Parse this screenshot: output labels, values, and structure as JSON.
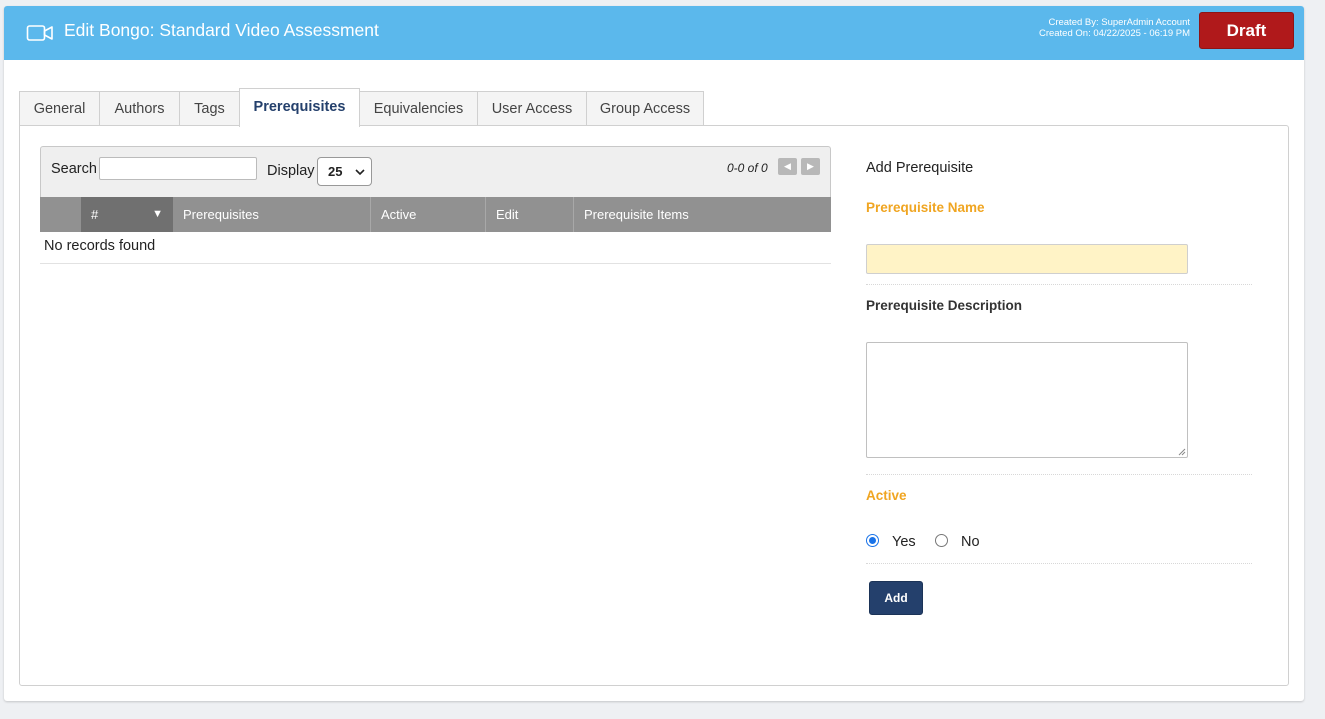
{
  "header": {
    "icon": "video-camera-icon",
    "title": "Edit Bongo: Standard Video Assessment",
    "created_by": "Created By: SuperAdmin Account",
    "created_on": "Created On: 04/22/2025 - 06:19 PM",
    "status_button": "Draft",
    "colors": {
      "bar": "#5bb8ec",
      "draft": "#b0191b"
    }
  },
  "tabs": [
    {
      "label": "General"
    },
    {
      "label": "Authors"
    },
    {
      "label": "Tags"
    },
    {
      "label": "Prerequisites",
      "active": true
    },
    {
      "label": "Equivalencies"
    },
    {
      "label": "User Access"
    },
    {
      "label": "Group Access"
    }
  ],
  "grid": {
    "search_label": "Search",
    "search_value": "",
    "display_label": "Display",
    "display_value": "25",
    "pager_text": "0-0 of 0",
    "columns": [
      "#",
      "Prerequisites",
      "Active",
      "Edit",
      "Prerequisite Items"
    ],
    "sorted_column": "#",
    "empty_text": "No records found"
  },
  "form": {
    "title": "Add Prerequisite",
    "name_label": "Prerequisite Name",
    "name_value": "",
    "description_label": "Prerequisite Description",
    "description_value": "",
    "active_label": "Active",
    "active_options": [
      "Yes",
      "No"
    ],
    "active_selected": "Yes",
    "submit_label": "Add",
    "colors": {
      "required_label": "#f0a521",
      "name_field": "#fff3c6",
      "button": "#24406c"
    }
  }
}
